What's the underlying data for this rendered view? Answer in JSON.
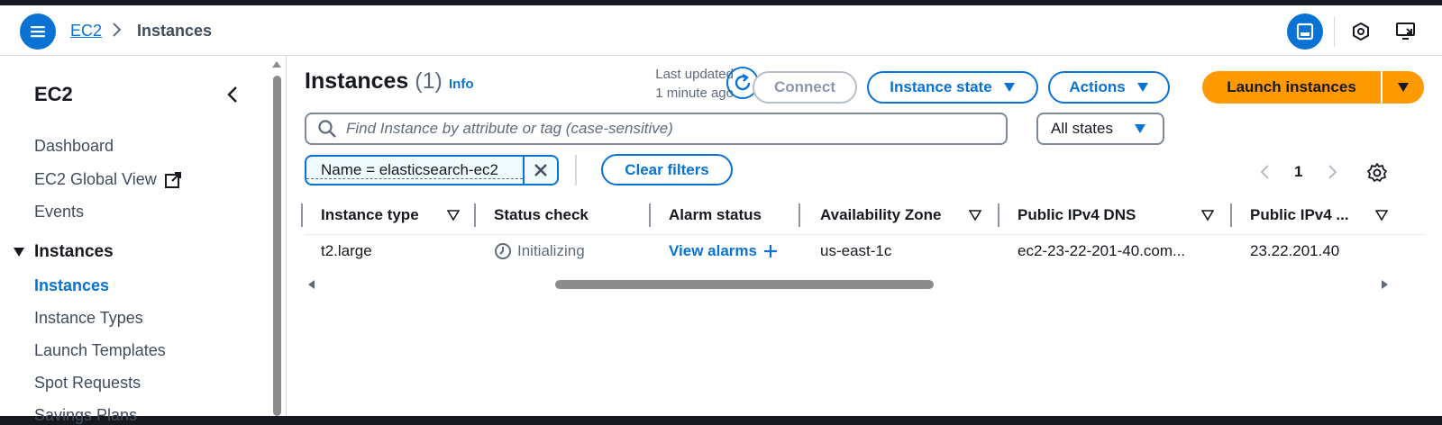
{
  "topbar": {
    "breadcrumb_service": "EC2",
    "breadcrumb_current": "Instances"
  },
  "sidebar": {
    "title": "EC2",
    "items": [
      {
        "label": "Dashboard"
      },
      {
        "label": "EC2 Global View"
      },
      {
        "label": "Events"
      }
    ],
    "section": {
      "label": "Instances"
    },
    "section_items": [
      {
        "label": "Instances",
        "active": true
      },
      {
        "label": "Instance Types"
      },
      {
        "label": "Launch Templates"
      },
      {
        "label": "Spot Requests"
      },
      {
        "label": "Savings Plans"
      }
    ]
  },
  "header": {
    "title": "Instances",
    "count": "(1)",
    "info": "Info",
    "last_updated_line1": "Last updated",
    "last_updated_line2": "1 minute ago",
    "connect_label": "Connect",
    "instance_state_label": "Instance state",
    "actions_label": "Actions",
    "launch_label": "Launch instances"
  },
  "filters": {
    "search_placeholder": "Find Instance by attribute or tag (case-sensitive)",
    "state_select": "All states",
    "token": "Name = elasticsearch-ec2",
    "clear_label": "Clear filters"
  },
  "pagination": {
    "current_page": "1"
  },
  "table": {
    "columns": [
      "Instance type",
      "Status check",
      "Alarm status",
      "Availability Zone",
      "Public IPv4 DNS",
      "Public IPv4 ..."
    ],
    "rows": [
      {
        "instance_type": "t2.large",
        "status_check": "Initializing",
        "alarm_status": "View alarms",
        "availability_zone": "us-east-1c",
        "public_dns": "ec2-23-22-201-40.com...",
        "public_ip": "23.22.201.40"
      }
    ]
  },
  "colors": {
    "accent": "#0972d3",
    "launch": "#ff9900"
  }
}
